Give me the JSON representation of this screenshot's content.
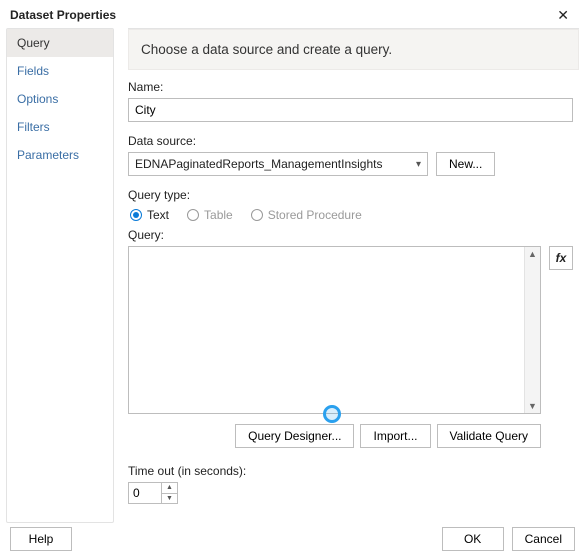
{
  "window": {
    "title": "Dataset Properties",
    "close": "✕"
  },
  "sidebar": {
    "items": [
      {
        "label": "Query"
      },
      {
        "label": "Fields"
      },
      {
        "label": "Options"
      },
      {
        "label": "Filters"
      },
      {
        "label": "Parameters"
      }
    ]
  },
  "header": {
    "text": "Choose a data source and create a query."
  },
  "form": {
    "name_label": "Name:",
    "name_value": "City",
    "datasource_label": "Data source:",
    "datasource_value": "EDNAPaginatedReports_ManagementInsights",
    "new_btn": "New...",
    "querytype_label": "Query type:",
    "querytypes": [
      {
        "label": "Text"
      },
      {
        "label": "Table"
      },
      {
        "label": "Stored Procedure"
      }
    ],
    "query_label": "Query:",
    "query_value": "",
    "fx_label": "fx",
    "designer_btn": "Query Designer...",
    "import_btn": "Import...",
    "validate_btn": "Validate Query",
    "timeout_label": "Time out (in seconds):",
    "timeout_value": "0"
  },
  "footer": {
    "help": "Help",
    "ok": "OK",
    "cancel": "Cancel"
  }
}
